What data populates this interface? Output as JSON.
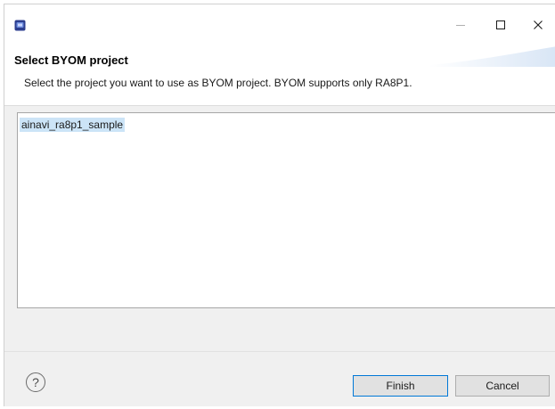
{
  "window": {
    "icon": "eclipse-app-icon",
    "controls": {
      "minimize": "minimize-icon",
      "maximize": "maximize-icon",
      "close": "close-icon"
    }
  },
  "header": {
    "title": "Select BYOM project",
    "description": "Select the project you want to use as BYOM project. BYOM supports only RA8P1."
  },
  "project_list": {
    "items": [
      {
        "label": "ainavi_ra8p1_sample",
        "selected": true
      }
    ]
  },
  "footer": {
    "help_glyph": "?",
    "finish_label": "Finish",
    "cancel_label": "Cancel"
  },
  "colors": {
    "selection": "#cce4f7",
    "default_button_border": "#0078d7",
    "panel_background": "#f0f0f0"
  }
}
